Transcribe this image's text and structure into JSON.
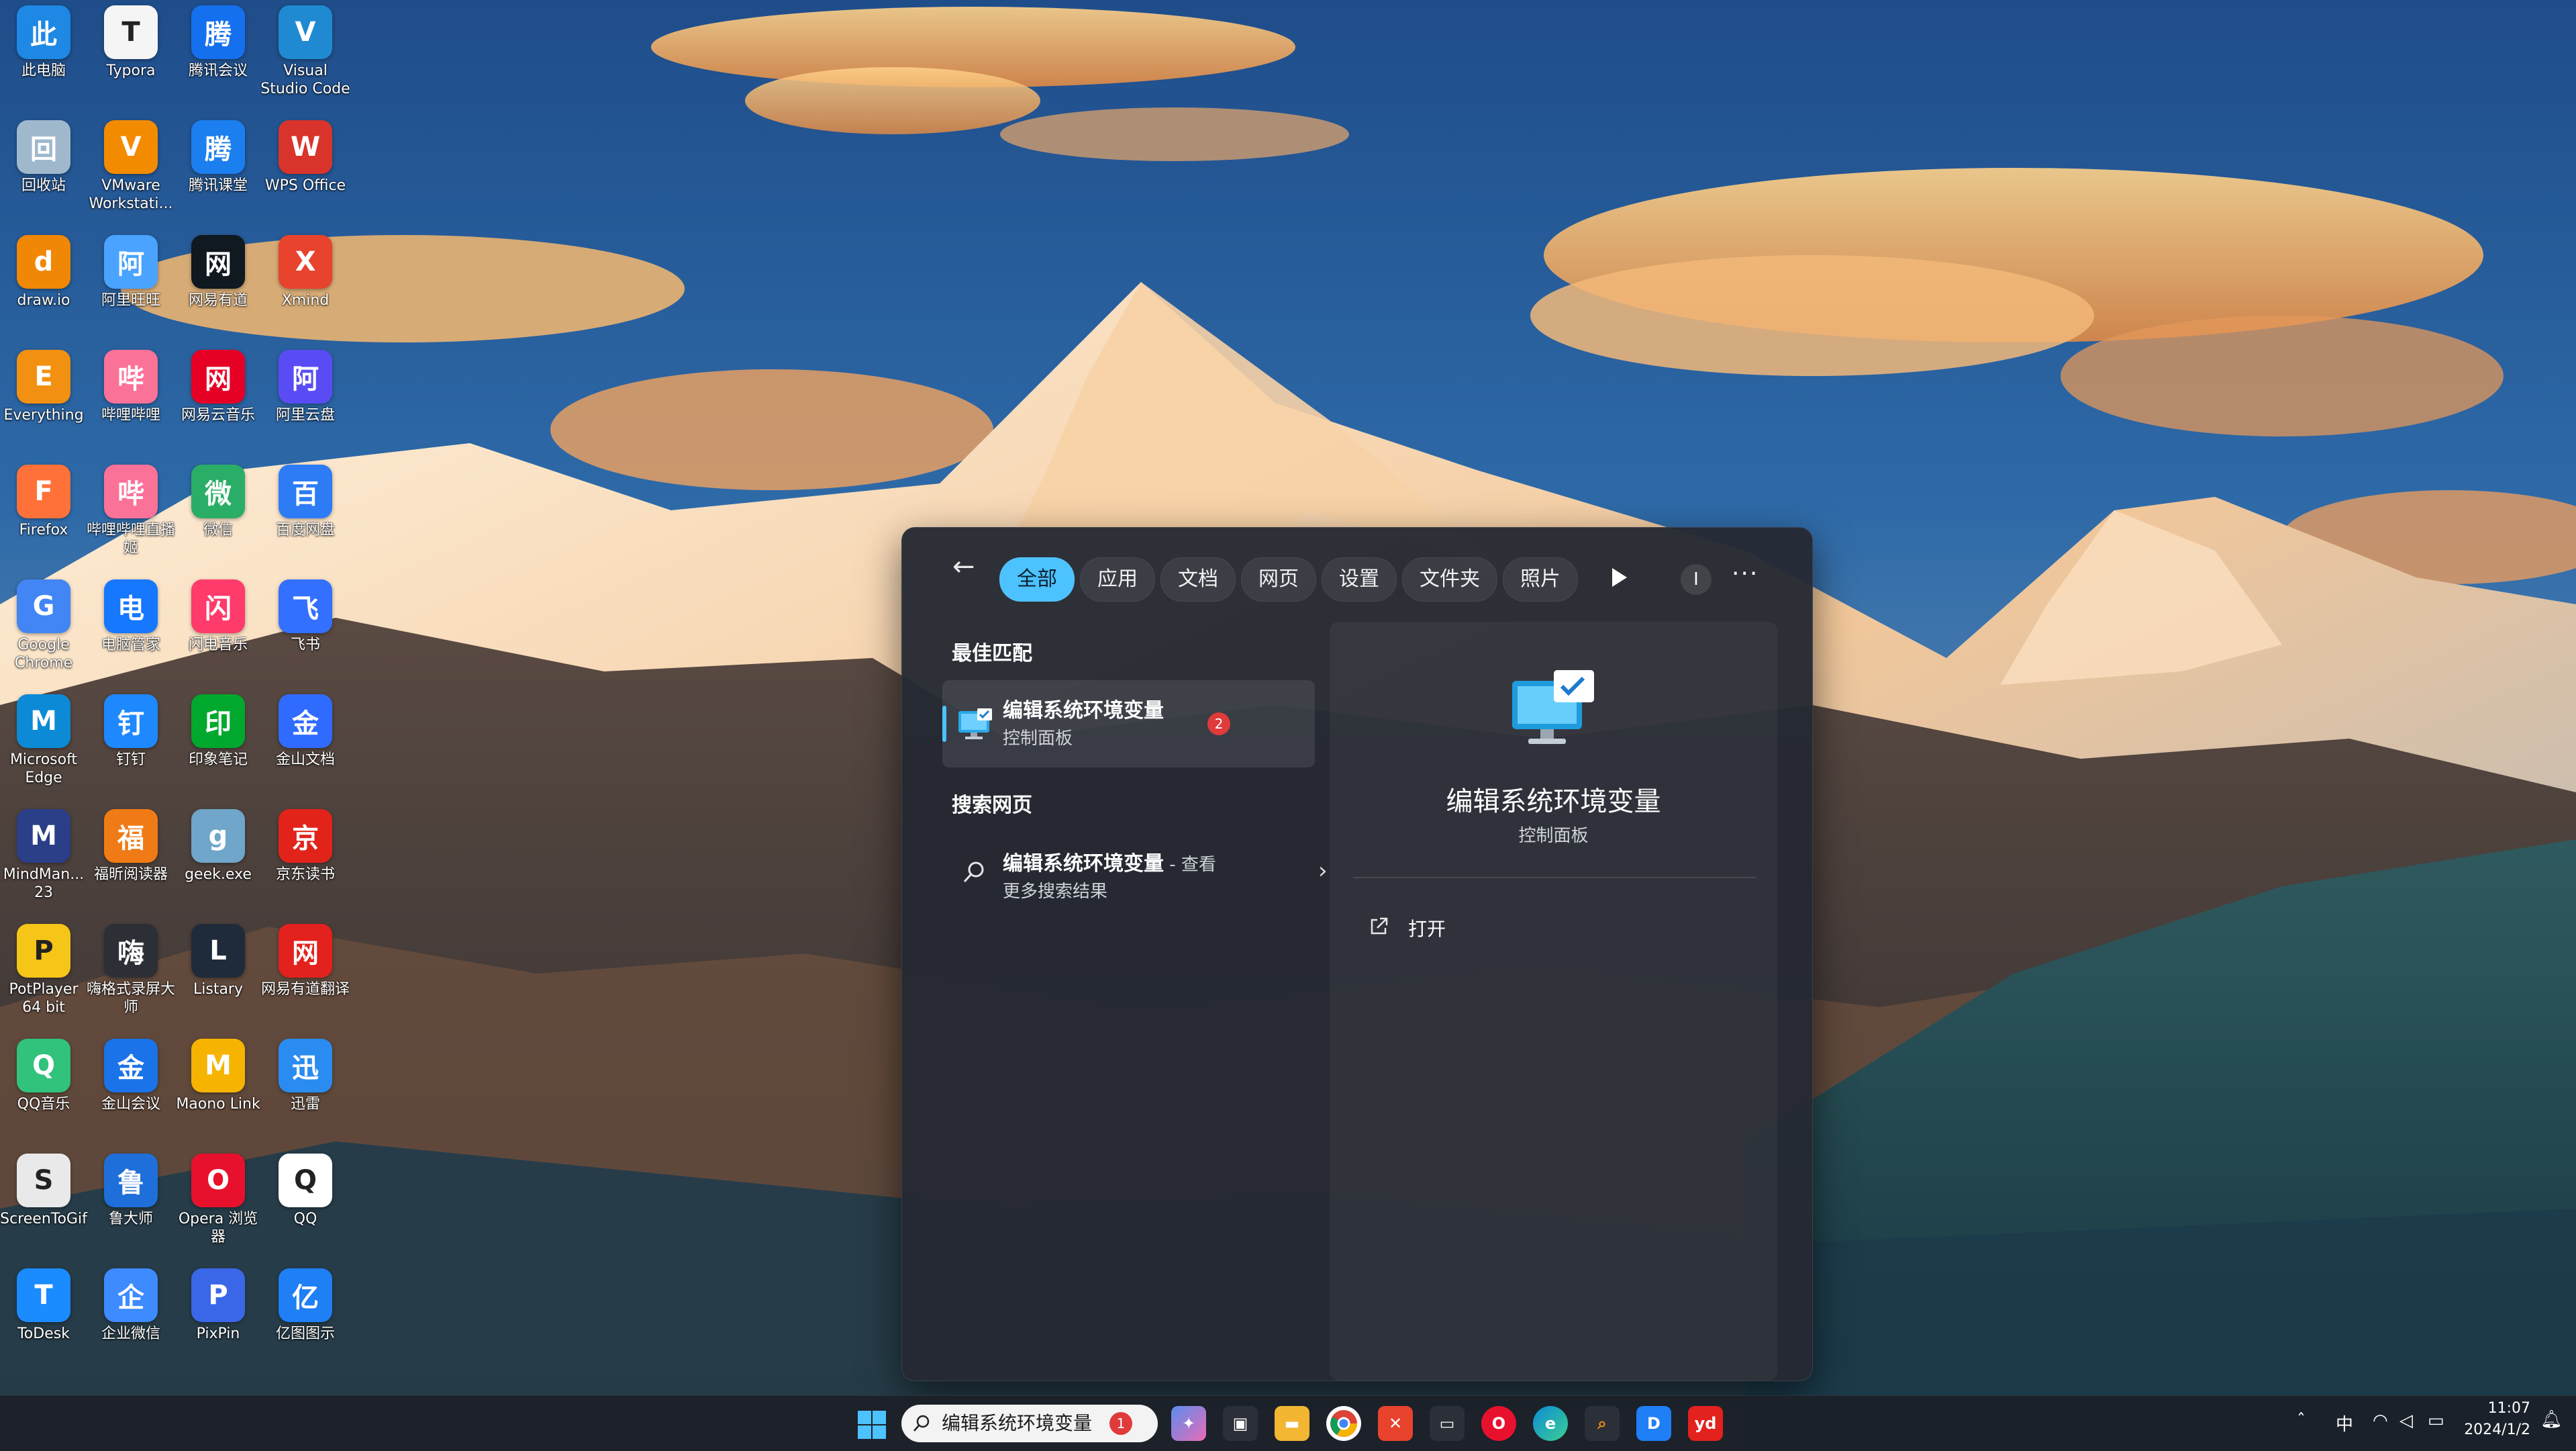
{
  "desktop": {
    "icons": [
      {
        "label": "此电脑",
        "icon": "computer-icon",
        "color": "#1e88e5"
      },
      {
        "label": "Typora",
        "icon": "typora-icon",
        "color": "#f5f5f5"
      },
      {
        "label": "腾讯会议",
        "icon": "tencent-meeting-icon",
        "color": "#1570ef"
      },
      {
        "label": "Visual Studio Code",
        "icon": "vscode-icon",
        "color": "#1f8ad2"
      },
      {
        "label": "回收站",
        "icon": "recycle-bin-icon",
        "color": "#9fb8cc"
      },
      {
        "label": "VMware Workstati...",
        "icon": "vmware-icon",
        "color": "#f38b00"
      },
      {
        "label": "腾讯课堂",
        "icon": "tencent-classroom-icon",
        "color": "#1c7ff0"
      },
      {
        "label": "WPS Office",
        "icon": "wps-icon",
        "color": "#d9342b"
      },
      {
        "label": "draw.io",
        "icon": "drawio-icon",
        "color": "#f08705"
      },
      {
        "label": "阿里旺旺",
        "icon": "aliwangwang-icon",
        "color": "#4aa3ff"
      },
      {
        "label": "网易有道",
        "icon": "netease-sync-icon",
        "color": "#101820"
      },
      {
        "label": "Xmind",
        "icon": "xmind-icon",
        "color": "#e8432d"
      },
      {
        "label": "Everything",
        "icon": "everything-icon",
        "color": "#f29111"
      },
      {
        "label": "哔哩哔哩",
        "icon": "bilibili-icon",
        "color": "#fb7299"
      },
      {
        "label": "网易云音乐",
        "icon": "netease-music-icon",
        "color": "#e60026"
      },
      {
        "label": "阿里云盘",
        "icon": "aliyun-drive-icon",
        "color": "#5a4cf5"
      },
      {
        "label": "Firefox",
        "icon": "firefox-icon",
        "color": "#ff7139"
      },
      {
        "label": "哔哩哔哩直播姬",
        "icon": "bilibili-live-icon",
        "color": "#fb7299"
      },
      {
        "label": "微信",
        "icon": "wechat-icon",
        "color": "#2aae67"
      },
      {
        "label": "百度网盘",
        "icon": "baidu-netdisk-icon",
        "color": "#2d7cf6"
      },
      {
        "label": "Google Chrome",
        "icon": "chrome-icon",
        "color": "#4285f4"
      },
      {
        "label": "电脑管家",
        "icon": "pc-manager-icon",
        "color": "#1677ff"
      },
      {
        "label": "闪电音乐",
        "icon": "flash-music-icon",
        "color": "#ff3b6b"
      },
      {
        "label": "飞书",
        "icon": "feishu-icon",
        "color": "#3370ff"
      },
      {
        "label": "Microsoft Edge",
        "icon": "edge-icon",
        "color": "#0c8ad6"
      },
      {
        "label": "钉钉",
        "icon": "dingtalk-icon",
        "color": "#1e88ff"
      },
      {
        "label": "印象笔记",
        "icon": "evernote-icon",
        "color": "#00a82d"
      },
      {
        "label": "金山文档",
        "icon": "kdocs-icon",
        "color": "#2f6bff"
      },
      {
        "label": "MindMan... 23",
        "icon": "mindmanager-icon",
        "color": "#2a3f87"
      },
      {
        "label": "福昕阅读器",
        "icon": "foxit-icon",
        "color": "#f07b16"
      },
      {
        "label": "geek.exe",
        "icon": "geek-icon",
        "color": "#6fa6c9"
      },
      {
        "label": "京东读书",
        "icon": "jd-read-icon",
        "color": "#e2231a"
      },
      {
        "label": "PotPlayer 64 bit",
        "icon": "potplayer-icon",
        "color": "#f5c518"
      },
      {
        "label": "嗨格式录屏大师",
        "icon": "screen-recorder-icon",
        "color": "#2d2f36"
      },
      {
        "label": "Listary",
        "icon": "listary-icon",
        "color": "#1f2b3a"
      },
      {
        "label": "网易有道翻译",
        "icon": "youdao-icon",
        "color": "#e3211d"
      },
      {
        "label": "QQ音乐",
        "icon": "qqmusic-icon",
        "color": "#31c27c"
      },
      {
        "label": "金山会议",
        "icon": "kmeeting-icon",
        "color": "#1a73e8"
      },
      {
        "label": "Maono Link",
        "icon": "maono-icon",
        "color": "#f6b400"
      },
      {
        "label": "迅雷",
        "icon": "xunlei-icon",
        "color": "#2a8cf0"
      },
      {
        "label": "ScreenToGif",
        "icon": "screentogif-icon",
        "color": "#e9e9e9"
      },
      {
        "label": "鲁大师",
        "icon": "ludashi-icon",
        "color": "#1e6fd9"
      },
      {
        "label": "Opera 浏览器",
        "icon": "opera-icon",
        "color": "#e8112d"
      },
      {
        "label": "QQ",
        "icon": "qq-icon",
        "color": "#ffffff"
      },
      {
        "label": "ToDesk",
        "icon": "todesk-icon",
        "color": "#1a8cff"
      },
      {
        "label": "企业微信",
        "icon": "wecom-icon",
        "color": "#3d8bff"
      },
      {
        "label": "PixPin",
        "icon": "pixpin-icon",
        "color": "#3a67e8"
      },
      {
        "label": "亿图图示",
        "icon": "edraw-icon",
        "color": "#1f7ff5"
      }
    ]
  },
  "search_panel": {
    "filters": [
      {
        "label": "全部",
        "active": true
      },
      {
        "label": "应用",
        "active": false
      },
      {
        "label": "文档",
        "active": false
      },
      {
        "label": "网页",
        "active": false
      },
      {
        "label": "设置",
        "active": false
      },
      {
        "label": "文件夹",
        "active": false
      },
      {
        "label": "照片",
        "active": false
      }
    ],
    "avatar_initial": "I",
    "more_label": "···",
    "best_match_heading": "最佳匹配",
    "best_match": {
      "title": "编辑系统环境变量",
      "subtitle": "控制面板",
      "badge": "2"
    },
    "web_heading": "搜索网页",
    "web_result": {
      "title": "编辑系统环境变量",
      "suffix": " - 查看",
      "subtitle": "更多搜索结果"
    },
    "detail": {
      "title": "编辑系统环境变量",
      "subtitle": "控制面板",
      "open_label": "打开"
    }
  },
  "taskbar": {
    "search_text": "编辑系统环境变量",
    "search_badge": "1",
    "ime": "中",
    "time": "11:07",
    "date": "2024/1/2",
    "accent": "#4cc2ff"
  }
}
